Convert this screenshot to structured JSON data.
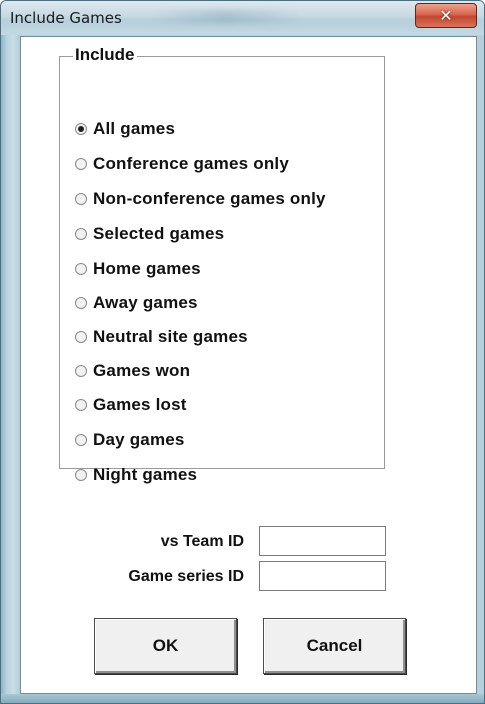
{
  "window": {
    "title": "Include Games",
    "close_icon": "close-icon"
  },
  "group": {
    "label": "Include",
    "selected_index": 0,
    "options": [
      "All games",
      "Conference games only",
      "Non-conference games only",
      "Selected games",
      "Home games",
      "Away games",
      "Neutral site games",
      "Games won",
      "Games lost",
      "Day games",
      "Night games"
    ]
  },
  "fields": {
    "team_id_label": "vs Team ID",
    "team_id_value": "",
    "series_id_label": "Game series ID",
    "series_id_value": ""
  },
  "buttons": {
    "ok": "OK",
    "cancel": "Cancel"
  }
}
